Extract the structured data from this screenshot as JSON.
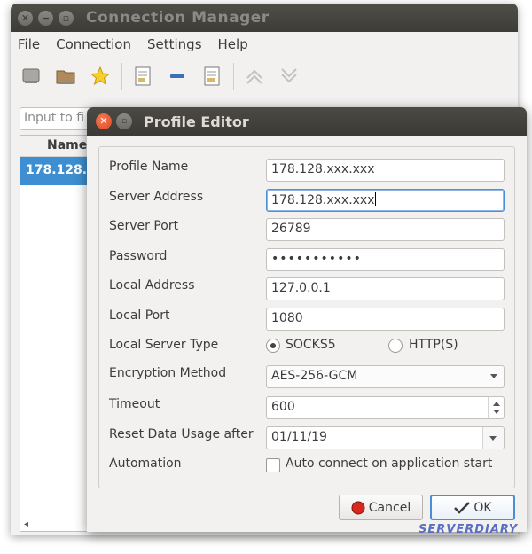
{
  "back_window": {
    "title": "Connection Manager",
    "menus": [
      "File",
      "Connection",
      "Settings",
      "Help"
    ],
    "toolbar_icons": [
      "server-icon",
      "folder-icon",
      "star-icon",
      "document-edit-icon",
      "remove-icon",
      "document-icon",
      "move-up-icon",
      "move-down-icon"
    ],
    "search_placeholder": "Input to fi",
    "list_header": "Name",
    "rows": [
      "178.128."
    ]
  },
  "dialog": {
    "title": "Profile Editor",
    "fields": {
      "profile_name": {
        "label": "Profile Name",
        "value": "178.128.xxx.xxx"
      },
      "server_address": {
        "label": "Server Address",
        "value": "178.128.xxx.xxx"
      },
      "server_port": {
        "label": "Server Port",
        "value": "26789"
      },
      "password": {
        "label": "Password",
        "value": "•••••••••••"
      },
      "local_address": {
        "label": "Local Address",
        "value": "127.0.0.1"
      },
      "local_port": {
        "label": "Local Port",
        "value": "1080"
      },
      "local_server_type": {
        "label": "Local Server Type",
        "option1": "SOCKS5",
        "option2": "HTTP(S)",
        "selected": "SOCKS5"
      },
      "encryption_method": {
        "label": "Encryption Method",
        "value": "AES-256-GCM"
      },
      "timeout": {
        "label": "Timeout",
        "value": "600"
      },
      "reset_data_usage": {
        "label": "Reset Data Usage after",
        "value": "01/11/19"
      },
      "automation": {
        "label": "Automation",
        "checkbox_label": "Auto connect on application start",
        "checked": false
      }
    },
    "buttons": {
      "cancel": "Cancel",
      "ok": "OK"
    }
  },
  "watermark": "SERVERDIARY",
  "colors": {
    "selection": "#3d8fd1",
    "focus": "#4a90d9",
    "close_button": "#e2522a"
  }
}
